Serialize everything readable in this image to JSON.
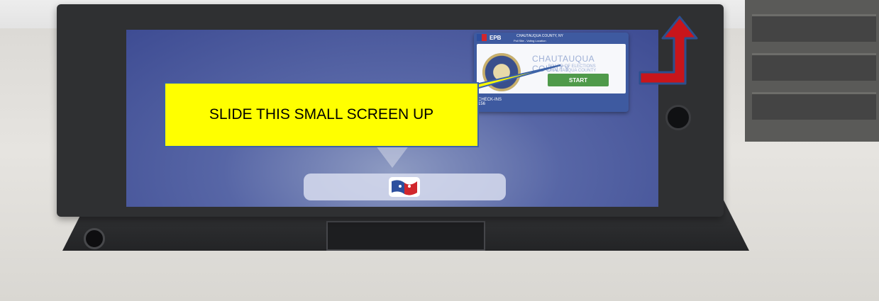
{
  "callout": {
    "text": "SLIDE THIS SMALL SCREEN UP"
  },
  "app_card": {
    "app_name": "EPB",
    "header_line1": "CHAUTAUQUA COUNTY, NY",
    "header_line2": "Poll Site - Voting Location",
    "county_title": "CHAUTAUQUA COUNTY",
    "board_name": "BOARD OF ELECTIONS",
    "board_sub": "CHAUTAUQUA COUNTY",
    "start_label": "START",
    "count_label": "CHECK-INS",
    "count_value": "156"
  },
  "colors": {
    "callout_fill": "#ffff00",
    "callout_border": "#3d63a8",
    "arrow": "#c8151b",
    "arrow_outline": "#2d4f8e",
    "start_button": "#4f9a4a"
  },
  "icons": {
    "arrow": "red-up-arrow-icon",
    "dock_app": "flag-app-icon",
    "seal": "county-seal-icon"
  }
}
